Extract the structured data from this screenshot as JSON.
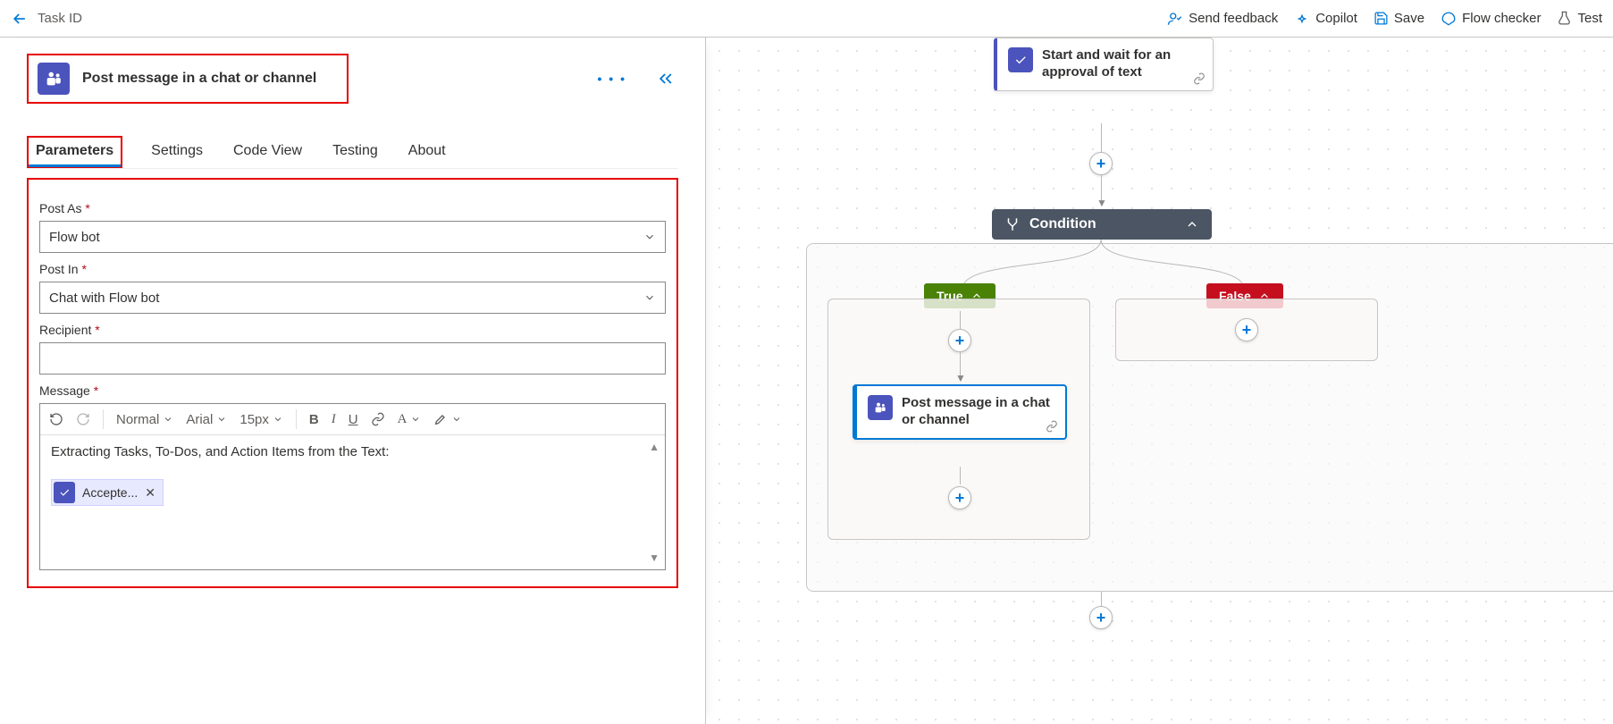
{
  "breadcrumb": "Task ID",
  "top_actions": {
    "feedback": "Send feedback",
    "copilot": "Copilot",
    "save": "Save",
    "flow_checker": "Flow checker",
    "test": "Test"
  },
  "action_header": {
    "title": "Post message in a chat or channel"
  },
  "tabs": {
    "parameters": "Parameters",
    "settings": "Settings",
    "code_view": "Code View",
    "testing": "Testing",
    "about": "About"
  },
  "fields": {
    "post_as": {
      "label": "Post As",
      "value": "Flow bot"
    },
    "post_in": {
      "label": "Post In",
      "value": "Chat with Flow bot"
    },
    "recipient": {
      "label": "Recipient",
      "value": ""
    },
    "message": {
      "label": "Message"
    }
  },
  "rte": {
    "style": "Normal",
    "font": "Arial",
    "size": "15px",
    "content_text": "Extracting Tasks, To-Dos, and Action Items from the Text:",
    "token_label": "Accepte..."
  },
  "canvas": {
    "approval_card": "Start and wait for an approval of text",
    "condition": "Condition",
    "true_label": "True",
    "false_label": "False",
    "post_card": "Post message in a chat or channel"
  }
}
